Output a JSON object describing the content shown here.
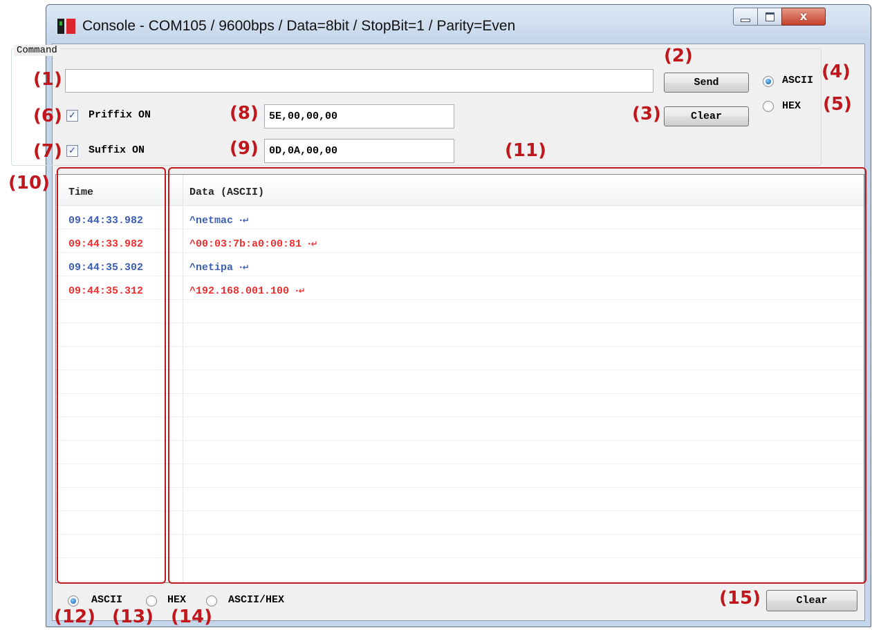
{
  "window": {
    "title": "Console - COM105 / 9600bps / Data=8bit / StopBit=1 / Parity=Even",
    "close_glyph": "x"
  },
  "command": {
    "group_label": "Command",
    "input_value": "",
    "send_label": "Send",
    "clear_label": "Clear",
    "mode_options": [
      "ASCII",
      "HEX"
    ],
    "mode_selected": "ASCII"
  },
  "prefix": {
    "label": "Priffix ON",
    "checked": true,
    "value": "5E,00,00,00"
  },
  "suffix": {
    "label": "Suffix ON",
    "checked": true,
    "value": "0D,0A,00,00"
  },
  "log": {
    "headers": {
      "time": "Time",
      "data": "Data (ASCII)"
    },
    "rows": [
      {
        "time": "09:44:33.982",
        "data": "^netmac",
        "eol": "·↵",
        "color": "#3b5eb4"
      },
      {
        "time": "09:44:33.982",
        "data": "^00:03:7b:a0:00:81",
        "eol": "·↵",
        "color": "#ef2f2f"
      },
      {
        "time": "09:44:35.302",
        "data": "^netipa",
        "eol": "·↵",
        "color": "#3b5eb4"
      },
      {
        "time": "09:44:35.312",
        "data": "^192.168.001.100",
        "eol": "·↵",
        "color": "#ef2f2f"
      }
    ]
  },
  "display_mode": {
    "options": [
      "ASCII",
      "HEX",
      "ASCII/HEX"
    ],
    "selected": "ASCII",
    "clear_label": "Clear"
  },
  "annotations": [
    "(1)",
    "(2)",
    "(3)",
    "(4)",
    "(5)",
    "(6)",
    "(7)",
    "(8)",
    "(9)",
    "(10)",
    "(11)",
    "(12)",
    "(13)",
    "(14)",
    "(15)"
  ],
  "colors": {
    "sent": "#3b5eb4",
    "received": "#ef2f2f",
    "annotation": "#c0171c"
  }
}
